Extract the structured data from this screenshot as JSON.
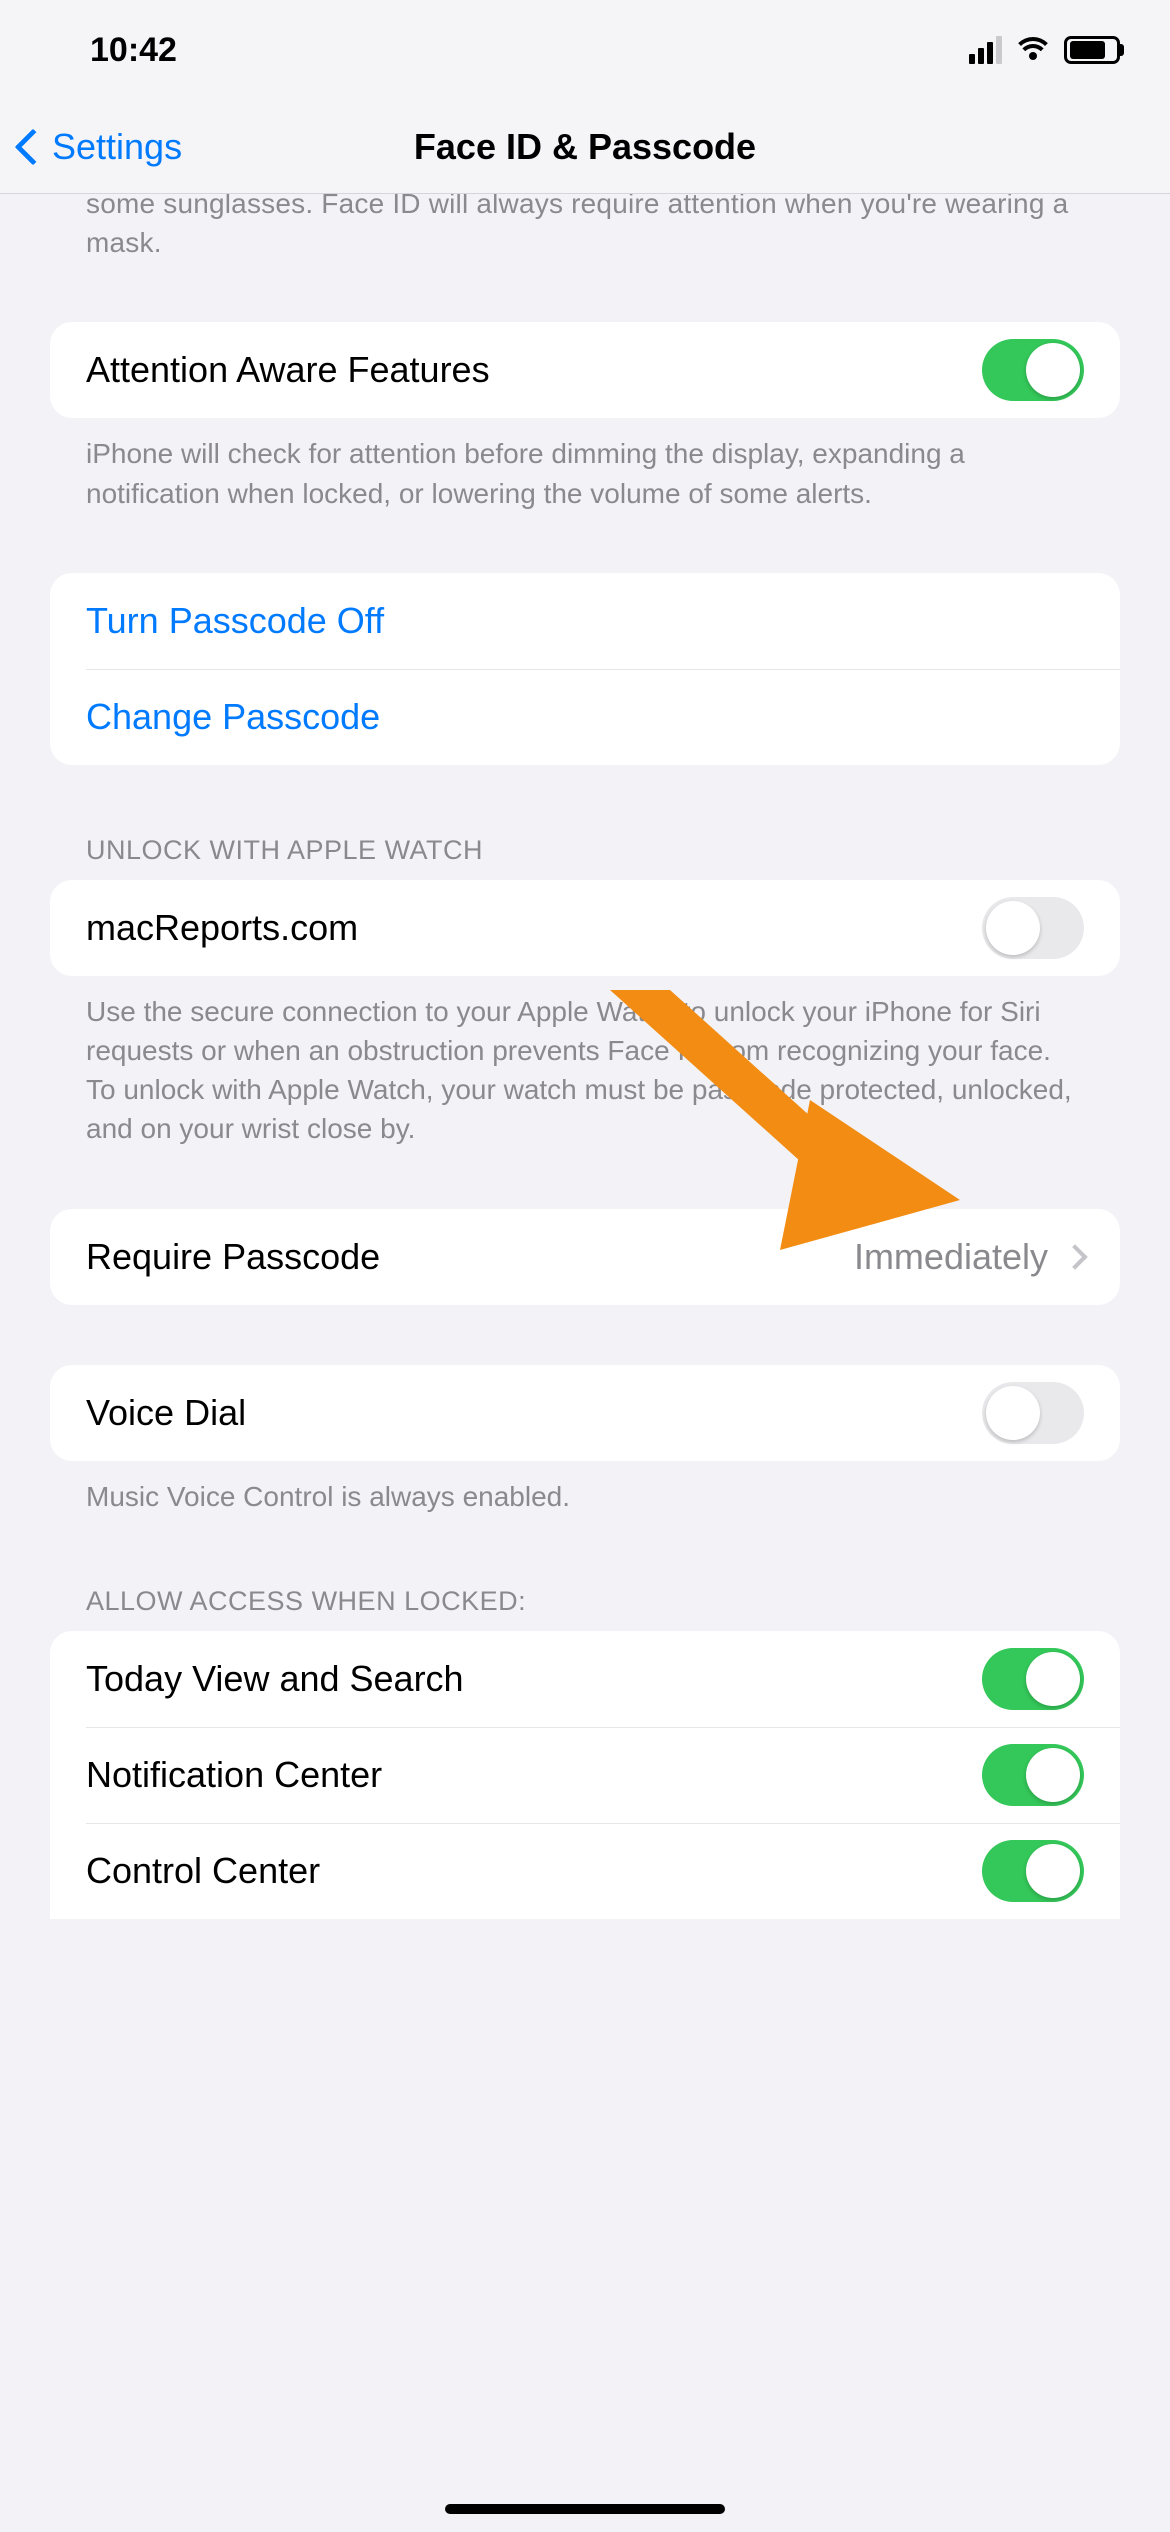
{
  "status": {
    "time": "10:42"
  },
  "nav": {
    "back": "Settings",
    "title": "Face ID & Passcode"
  },
  "cutoff_text": "some sunglasses. Face ID will always require attention when you're wearing a mask.",
  "attention": {
    "label": "Attention Aware Features",
    "on": true,
    "footer": "iPhone will check for attention before dimming the display, expanding a notification when locked, or lowering the volume of some alerts."
  },
  "passcode": {
    "turn_off": "Turn Passcode Off",
    "change": "Change Passcode"
  },
  "watch": {
    "header": "UNLOCK WITH APPLE WATCH",
    "label": "macReports.com",
    "on": false,
    "footer": "Use the secure connection to your Apple Watch to unlock your iPhone for Siri requests or when an obstruction prevents Face ID from recognizing your face. To unlock with Apple Watch, your watch must be passcode protected, unlocked, and on your wrist close by."
  },
  "require": {
    "label": "Require Passcode",
    "value": "Immediately"
  },
  "voice": {
    "label": "Voice Dial",
    "on": false,
    "footer": "Music Voice Control is always enabled."
  },
  "locked": {
    "header": "ALLOW ACCESS WHEN LOCKED:",
    "items": [
      {
        "label": "Today View and Search",
        "on": true
      },
      {
        "label": "Notification Center",
        "on": true
      },
      {
        "label": "Control Center",
        "on": true
      }
    ]
  }
}
